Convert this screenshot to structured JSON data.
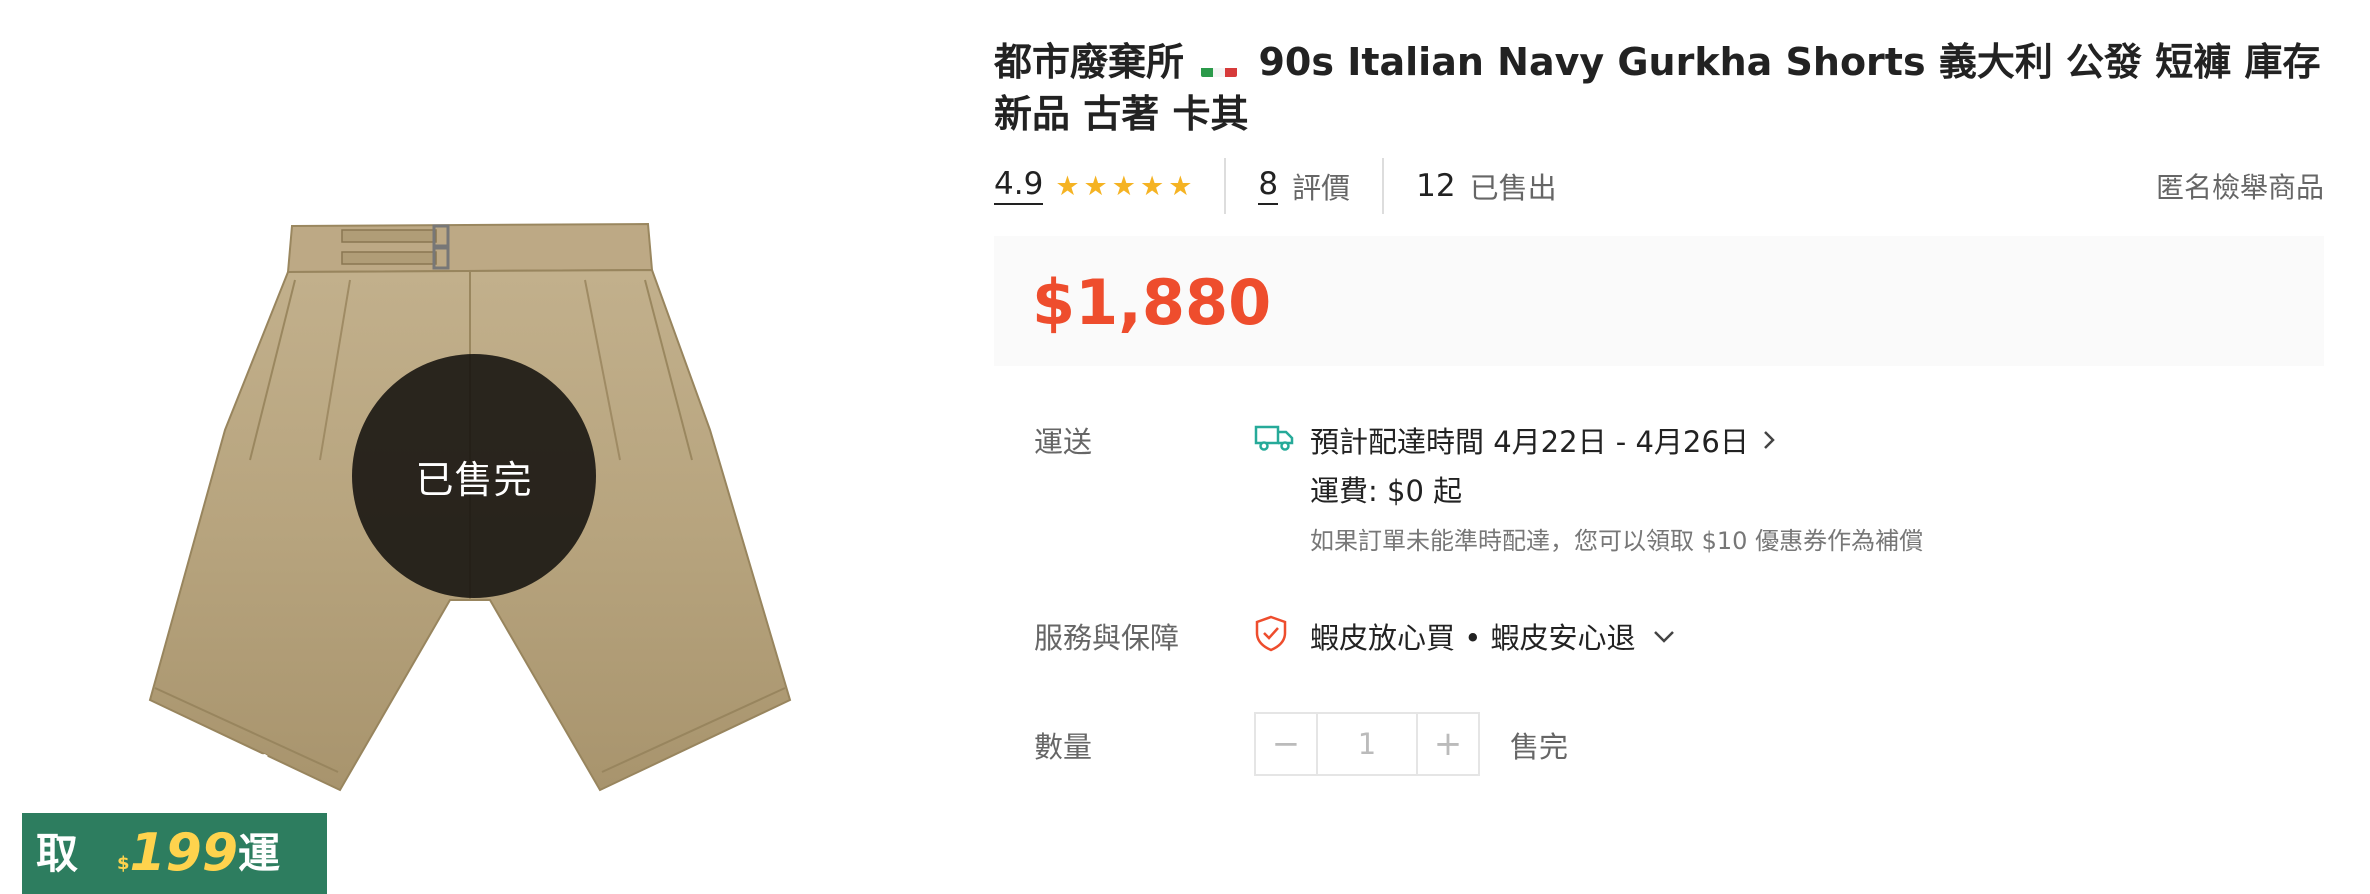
{
  "image_overlay": {
    "soldout_label": "已售完",
    "promo": {
      "text_prefix": "店取",
      "currency": "$",
      "amount": "199",
      "text_suffix": "免運"
    }
  },
  "product": {
    "title_prefix": "都市廢棄所",
    "flag": "italy-flag",
    "title_en": "90s Italian Navy Gurkha Shorts",
    "title_suffix": "義大利 公發 短褲 庫存新品 古著 卡其"
  },
  "rating": {
    "value": "4.9",
    "stars": 5,
    "reviews_count": "8",
    "reviews_label": "評價",
    "sold_count": "12",
    "sold_label": "已售出",
    "report_label": "匿名檢舉商品"
  },
  "price": "$1,880",
  "shipping": {
    "label": "運送",
    "eta": "預計配達時間 4月22日 - 4月26日",
    "fee": "運費:  $0 起",
    "note": "如果訂單未能準時配達，您可以領取 $10 優惠券作為補償"
  },
  "guarantee": {
    "label": "服務與保障",
    "text": "蝦皮放心買 • 蝦皮安心退"
  },
  "quantity": {
    "label": "數量",
    "value": "1",
    "minus": "−",
    "plus": "+",
    "status": "售完"
  },
  "colors": {
    "price": "#ee4d2d",
    "star": "#f5b323",
    "promo_bg": "#2d7d5f",
    "ship_icon": "#26aa99",
    "guard_icon": "#ee4d2d"
  }
}
